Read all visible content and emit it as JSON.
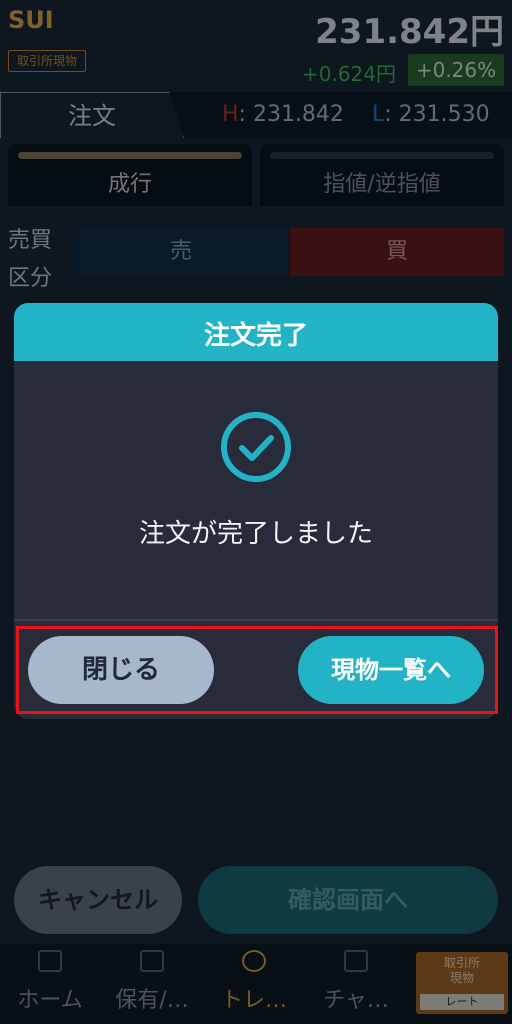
{
  "header": {
    "symbol": "SUI",
    "market_badge": "取引所現物",
    "price": "231.842円",
    "change": "+0.624円",
    "change_pct": "+0.26%"
  },
  "tabs": {
    "order_tab": "注文",
    "high_key": "H",
    "high_value": ": 231.842",
    "low_key": "L",
    "low_value": ": 231.530"
  },
  "order_types": {
    "market": "成行",
    "limit": "指値/逆指値"
  },
  "form": {
    "side_label": "売買",
    "type_label": "区分",
    "sell": "売",
    "buy": "買"
  },
  "dialog": {
    "title": "注文完了",
    "message": "注文が完了しました",
    "close_button": "閉じる",
    "list_button": "現物一覧へ"
  },
  "footer_buttons": {
    "cancel": "キャンセル",
    "confirm": "確認画面へ"
  },
  "bottom_nav": {
    "items": [
      {
        "label": "ホーム",
        "icon": "grid-icon"
      },
      {
        "label": "保有/…",
        "icon": "wallet-icon"
      },
      {
        "label": "トレ…",
        "icon": "trade-icon"
      },
      {
        "label": "チャ…",
        "icon": "chart-icon"
      }
    ],
    "rate_top": "取引所\n現物",
    "rate_bottom": "レート"
  },
  "colors": {
    "accent": "#22b4c6",
    "highlight_frame": "#e8141c",
    "up": "#3fbd5a"
  }
}
